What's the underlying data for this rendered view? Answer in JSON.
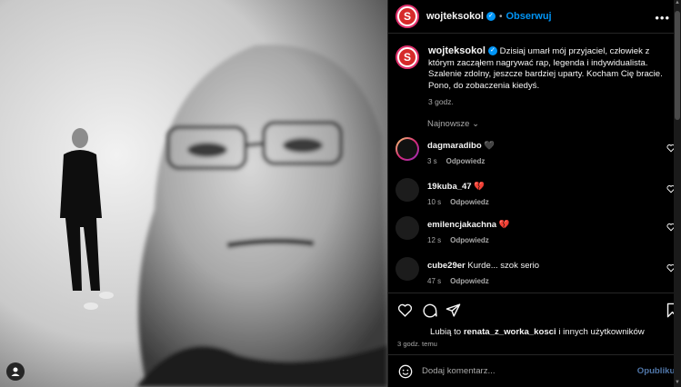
{
  "post": {
    "username": "wojteksokol",
    "follow_label": "Obserwuj",
    "avatar_letter": "S",
    "caption": "Dzisiaj umarł mój przyjaciel, człowiek z którym zacząłem nagrywać rap, legenda i indywidualista. Szalenie zdolny, jeszcze bardziej uparty. Kocham Cię bracie. Pono, do zobaczenia kiedyś.",
    "caption_time": "3 godz."
  },
  "sort_label": "Najnowsze",
  "comments": [
    {
      "user": "dagmaradibo",
      "text": "🖤",
      "time": "3 s",
      "reply": "Odpowiedz"
    },
    {
      "user": "19kuba_47",
      "text": "💔",
      "time": "10 s",
      "reply": "Odpowiedz"
    },
    {
      "user": "emilencjakachna",
      "text": "💔",
      "time": "12 s",
      "reply": "Odpowiedz"
    },
    {
      "user": "cube29er",
      "text": "Kurde... szok serio",
      "time": "47 s",
      "reply": "Odpowiedz"
    }
  ],
  "likes": {
    "prefix": "Lubią to",
    "user": "renata_z_worka_kosci",
    "suffix": "i innych użytkowników"
  },
  "post_time": "3 godz. temu",
  "add_comment": {
    "placeholder": "Dodaj komentarz...",
    "publish_label": "Opublikuj"
  },
  "icons": {
    "like": "heart-icon",
    "comment": "comment-icon",
    "share": "share-icon",
    "save": "bookmark-icon",
    "emoji": "emoji-icon",
    "more": "more-options-icon",
    "tagged_user": "user-tag-icon",
    "verified": "verified-badge-icon"
  },
  "colors": {
    "accent_blue": "#0095f6",
    "background": "#000000",
    "avatar_red": "#d62a2a"
  }
}
